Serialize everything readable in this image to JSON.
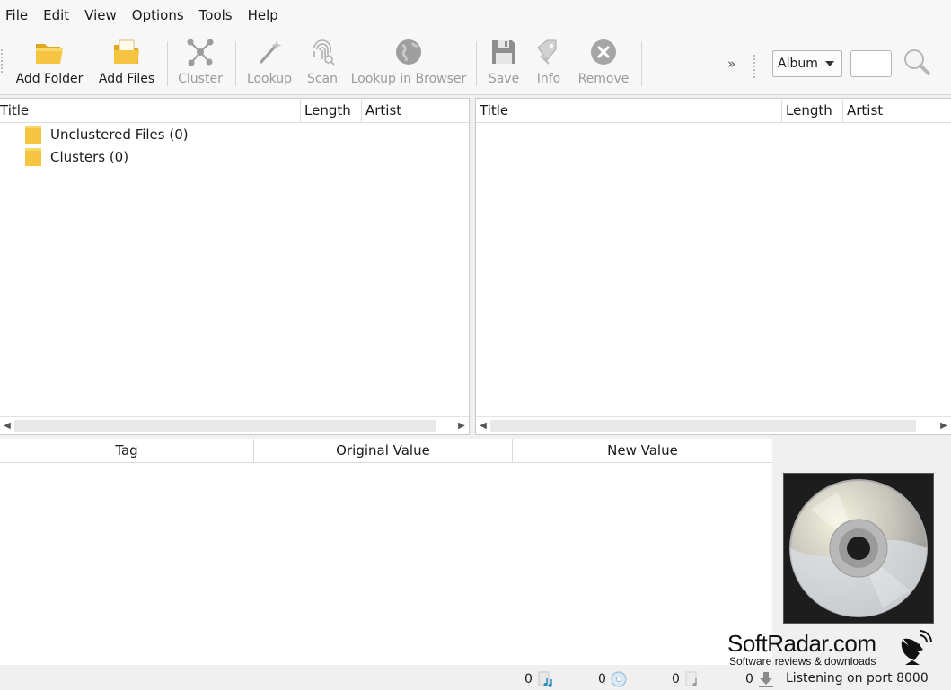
{
  "menu": [
    "File",
    "Edit",
    "View",
    "Options",
    "Tools",
    "Help"
  ],
  "toolbar": {
    "add_folder": "Add Folder",
    "add_files": "Add Files",
    "cluster": "Cluster",
    "lookup": "Lookup",
    "scan": "Scan",
    "lookup_browser": "Lookup in Browser",
    "save": "Save",
    "info": "Info",
    "remove": "Remove",
    "more": "»",
    "search_type": "Album"
  },
  "left_pane": {
    "columns": [
      "Title",
      "Length",
      "Artist"
    ],
    "items": [
      "Unclustered Files (0)",
      "Clusters (0)"
    ]
  },
  "right_pane": {
    "columns": [
      "Title",
      "Length",
      "Artist"
    ]
  },
  "tag_table": {
    "columns": [
      "Tag",
      "Original Value",
      "New Value"
    ]
  },
  "watermark": {
    "name": "SoftRadar.com",
    "tagline": "Software reviews & downloads"
  },
  "status": {
    "files_count": "0",
    "albums_count": "0",
    "pending_files": "0",
    "pending_requests": "0",
    "message": "Listening on port 8000"
  },
  "colors": {
    "folder": "#f5c542",
    "folder_dark": "#e0a820",
    "disabled_icon": "#a8a8a8"
  }
}
